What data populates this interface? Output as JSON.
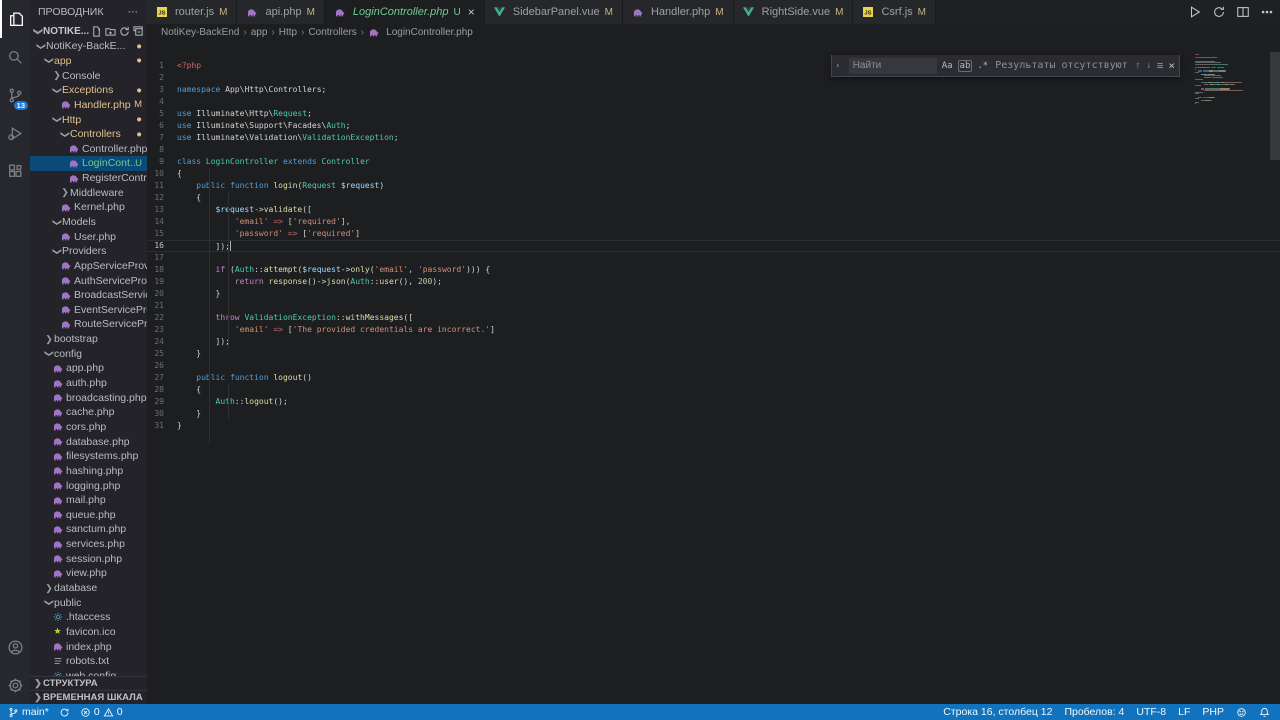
{
  "activity_bar": {
    "scm_badge": "13"
  },
  "sidebar": {
    "title": "ПРОВОДНИК",
    "title_more": "⋯",
    "section": "NOTIKE...",
    "outline": "СТРУКТУРА",
    "timeline": "ВРЕМЕННАЯ ШКАЛА",
    "tree": [
      {
        "label": "NotiKey-BackE...",
        "lvl": 0,
        "kind": "folder",
        "state": "open",
        "badge": "dot"
      },
      {
        "label": "app",
        "lvl": 1,
        "kind": "folder",
        "state": "open",
        "color": "mod",
        "badge": "dot"
      },
      {
        "label": "Console",
        "lvl": 2,
        "kind": "folder",
        "state": "closed"
      },
      {
        "label": "Exceptions",
        "lvl": 2,
        "kind": "folder",
        "state": "open",
        "color": "mod",
        "badge": "dot"
      },
      {
        "label": "Handler.php",
        "lvl": 3,
        "kind": "file",
        "icon": "php",
        "color": "mod",
        "badge": "M"
      },
      {
        "label": "Http",
        "lvl": 2,
        "kind": "folder",
        "state": "open",
        "color": "mod",
        "badge": "dot"
      },
      {
        "label": "Controllers",
        "lvl": 3,
        "kind": "folder",
        "state": "open",
        "color": "mod",
        "badge": "dot"
      },
      {
        "label": "Controller.php",
        "lvl": 4,
        "kind": "file",
        "icon": "php"
      },
      {
        "label": "LoginCont...",
        "lvl": 4,
        "kind": "file",
        "icon": "php",
        "color": "unt",
        "badge": "U",
        "selected": true
      },
      {
        "label": "RegisterContro...",
        "lvl": 4,
        "kind": "file",
        "icon": "php"
      },
      {
        "label": "Middleware",
        "lvl": 3,
        "kind": "folder",
        "state": "closed"
      },
      {
        "label": "Kernel.php",
        "lvl": 3,
        "kind": "file",
        "icon": "php"
      },
      {
        "label": "Models",
        "lvl": 2,
        "kind": "folder",
        "state": "open"
      },
      {
        "label": "User.php",
        "lvl": 3,
        "kind": "file",
        "icon": "php"
      },
      {
        "label": "Providers",
        "lvl": 2,
        "kind": "folder",
        "state": "open"
      },
      {
        "label": "AppServiceProvi...",
        "lvl": 3,
        "kind": "file",
        "icon": "php"
      },
      {
        "label": "AuthServiceProv...",
        "lvl": 3,
        "kind": "file",
        "icon": "php"
      },
      {
        "label": "BroadcastServic...",
        "lvl": 3,
        "kind": "file",
        "icon": "php"
      },
      {
        "label": "EventServicePro...",
        "lvl": 3,
        "kind": "file",
        "icon": "php"
      },
      {
        "label": "RouteServicePro...",
        "lvl": 3,
        "kind": "file",
        "icon": "php"
      },
      {
        "label": "bootstrap",
        "lvl": 1,
        "kind": "folder",
        "state": "closed"
      },
      {
        "label": "config",
        "lvl": 1,
        "kind": "folder",
        "state": "open"
      },
      {
        "label": "app.php",
        "lvl": 2,
        "kind": "file",
        "icon": "php"
      },
      {
        "label": "auth.php",
        "lvl": 2,
        "kind": "file",
        "icon": "php"
      },
      {
        "label": "broadcasting.php",
        "lvl": 2,
        "kind": "file",
        "icon": "php"
      },
      {
        "label": "cache.php",
        "lvl": 2,
        "kind": "file",
        "icon": "php"
      },
      {
        "label": "cors.php",
        "lvl": 2,
        "kind": "file",
        "icon": "php"
      },
      {
        "label": "database.php",
        "lvl": 2,
        "kind": "file",
        "icon": "php"
      },
      {
        "label": "filesystems.php",
        "lvl": 2,
        "kind": "file",
        "icon": "php"
      },
      {
        "label": "hashing.php",
        "lvl": 2,
        "kind": "file",
        "icon": "php"
      },
      {
        "label": "logging.php",
        "lvl": 2,
        "kind": "file",
        "icon": "php"
      },
      {
        "label": "mail.php",
        "lvl": 2,
        "kind": "file",
        "icon": "php"
      },
      {
        "label": "queue.php",
        "lvl": 2,
        "kind": "file",
        "icon": "php"
      },
      {
        "label": "sanctum.php",
        "lvl": 2,
        "kind": "file",
        "icon": "php"
      },
      {
        "label": "services.php",
        "lvl": 2,
        "kind": "file",
        "icon": "php"
      },
      {
        "label": "session.php",
        "lvl": 2,
        "kind": "file",
        "icon": "php"
      },
      {
        "label": "view.php",
        "lvl": 2,
        "kind": "file",
        "icon": "php"
      },
      {
        "label": "database",
        "lvl": 1,
        "kind": "folder",
        "state": "closed"
      },
      {
        "label": "public",
        "lvl": 1,
        "kind": "folder",
        "state": "open"
      },
      {
        "label": ".htaccess",
        "lvl": 2,
        "kind": "file",
        "icon": "gear"
      },
      {
        "label": "favicon.ico",
        "lvl": 2,
        "kind": "file",
        "icon": "star"
      },
      {
        "label": "index.php",
        "lvl": 2,
        "kind": "file",
        "icon": "php"
      },
      {
        "label": "robots.txt",
        "lvl": 2,
        "kind": "file",
        "icon": "txt"
      },
      {
        "label": "web.config",
        "lvl": 2,
        "kind": "file",
        "icon": "gear"
      }
    ]
  },
  "tabs": [
    {
      "name": "router.js",
      "icon": "js",
      "badge": "M"
    },
    {
      "name": "api.php",
      "icon": "php",
      "badge": "M"
    },
    {
      "name": "LoginController.php",
      "icon": "php",
      "badge": "U",
      "active": true
    },
    {
      "name": "SidebarPanel.vue",
      "icon": "vue",
      "badge": "M"
    },
    {
      "name": "Handler.php",
      "icon": "php",
      "badge": "M"
    },
    {
      "name": "RightSide.vue",
      "icon": "vue",
      "badge": "M"
    },
    {
      "name": "Csrf.js",
      "icon": "js",
      "badge": "M"
    }
  ],
  "breadcrumbs": [
    "NotiKey-BackEnd",
    "app",
    "Http",
    "Controllers",
    "LoginController.php"
  ],
  "find": {
    "placeholder": "Найти",
    "match_case": "Aa",
    "whole_word": "ab",
    "regex": ".*",
    "results": "Результаты отсутствуют",
    "prev": "↑",
    "next": "↓",
    "in_selection": "≡",
    "close": "×",
    "toggle": "›"
  },
  "editor": {
    "current_line": 16,
    "lines": [
      {
        "n": 1,
        "t": [
          [
            "<?php",
            "php"
          ]
        ]
      },
      {
        "n": 2,
        "t": []
      },
      {
        "n": 3,
        "t": [
          [
            "namespace",
            "k"
          ],
          [
            " App\\Http\\Controllers;",
            "d"
          ]
        ]
      },
      {
        "n": 4,
        "t": []
      },
      {
        "n": 5,
        "t": [
          [
            "use",
            "k"
          ],
          [
            " Illuminate\\Http\\",
            "d"
          ],
          [
            "Request",
            "cls"
          ],
          [
            ";",
            "d"
          ]
        ]
      },
      {
        "n": 6,
        "t": [
          [
            "use",
            "k"
          ],
          [
            " Illuminate\\Support\\Facades\\",
            "d"
          ],
          [
            "Auth",
            "cls"
          ],
          [
            ";",
            "d"
          ]
        ]
      },
      {
        "n": 7,
        "t": [
          [
            "use",
            "k"
          ],
          [
            " Illuminate\\Validation\\",
            "d"
          ],
          [
            "ValidationException",
            "cls"
          ],
          [
            ";",
            "d"
          ]
        ]
      },
      {
        "n": 8,
        "t": []
      },
      {
        "n": 9,
        "t": [
          [
            "class",
            "k"
          ],
          [
            " ",
            "d"
          ],
          [
            "LoginController",
            "cls"
          ],
          [
            " ",
            "d"
          ],
          [
            "extends",
            "k"
          ],
          [
            " ",
            "d"
          ],
          [
            "Controller",
            "cls"
          ]
        ]
      },
      {
        "n": 10,
        "t": [
          [
            "{",
            "d"
          ]
        ]
      },
      {
        "n": 11,
        "t": [
          [
            "    ",
            "d"
          ],
          [
            "public",
            "k"
          ],
          [
            " ",
            "d"
          ],
          [
            "function",
            "k"
          ],
          [
            " ",
            "d"
          ],
          [
            "login",
            "fn"
          ],
          [
            "(",
            "d"
          ],
          [
            "Request",
            "cls"
          ],
          [
            " ",
            "d"
          ],
          [
            "$request",
            "var"
          ],
          [
            ")",
            "d"
          ]
        ]
      },
      {
        "n": 12,
        "t": [
          [
            "    {",
            "d"
          ]
        ]
      },
      {
        "n": 13,
        "t": [
          [
            "        ",
            "d"
          ],
          [
            "$request",
            "var"
          ],
          [
            "->",
            "d"
          ],
          [
            "validate",
            "fn"
          ],
          [
            "([",
            "d"
          ]
        ]
      },
      {
        "n": 14,
        "t": [
          [
            "            ",
            "d"
          ],
          [
            "'email'",
            "str"
          ],
          [
            " ",
            "d"
          ],
          [
            "=>",
            "op"
          ],
          [
            " [",
            "d"
          ],
          [
            "'required'",
            "str"
          ],
          [
            "],",
            "d"
          ]
        ]
      },
      {
        "n": 15,
        "t": [
          [
            "            ",
            "d"
          ],
          [
            "'password'",
            "str"
          ],
          [
            " ",
            "d"
          ],
          [
            "=>",
            "op"
          ],
          [
            " [",
            "d"
          ],
          [
            "'required'",
            "str"
          ],
          [
            "]",
            "d"
          ]
        ]
      },
      {
        "n": 16,
        "t": [
          [
            "        ]);",
            "d"
          ]
        ]
      },
      {
        "n": 17,
        "t": []
      },
      {
        "n": 18,
        "t": [
          [
            "        ",
            "d"
          ],
          [
            "if",
            "ctl"
          ],
          [
            " (",
            "d"
          ],
          [
            "Auth",
            "cls"
          ],
          [
            "::",
            "d"
          ],
          [
            "attempt",
            "fn"
          ],
          [
            "(",
            "d"
          ],
          [
            "$request",
            "var"
          ],
          [
            "->",
            "d"
          ],
          [
            "only",
            "fn"
          ],
          [
            "(",
            "d"
          ],
          [
            "'email'",
            "str"
          ],
          [
            ", ",
            "d"
          ],
          [
            "'password'",
            "str"
          ],
          [
            "))) {",
            "d"
          ]
        ]
      },
      {
        "n": 19,
        "t": [
          [
            "            ",
            "d"
          ],
          [
            "return",
            "ctl"
          ],
          [
            " ",
            "d"
          ],
          [
            "response",
            "fn"
          ],
          [
            "()->",
            "d"
          ],
          [
            "json",
            "fn"
          ],
          [
            "(",
            "d"
          ],
          [
            "Auth",
            "cls"
          ],
          [
            "::",
            "d"
          ],
          [
            "user",
            "fn"
          ],
          [
            "(), ",
            "d"
          ],
          [
            "200",
            "num"
          ],
          [
            ");",
            "d"
          ]
        ]
      },
      {
        "n": 20,
        "t": [
          [
            "        }",
            "d"
          ]
        ]
      },
      {
        "n": 21,
        "t": []
      },
      {
        "n": 22,
        "t": [
          [
            "        ",
            "d"
          ],
          [
            "throw",
            "ctl"
          ],
          [
            " ",
            "d"
          ],
          [
            "ValidationException",
            "cls"
          ],
          [
            "::",
            "d"
          ],
          [
            "withMessages",
            "fn"
          ],
          [
            "([",
            "d"
          ]
        ]
      },
      {
        "n": 23,
        "t": [
          [
            "            ",
            "d"
          ],
          [
            "'email'",
            "str"
          ],
          [
            " ",
            "d"
          ],
          [
            "=>",
            "op"
          ],
          [
            " [",
            "d"
          ],
          [
            "'The provided credentials are incorrect.'",
            "str"
          ],
          [
            "]",
            "d"
          ]
        ]
      },
      {
        "n": 24,
        "t": [
          [
            "        ]);",
            "d"
          ]
        ]
      },
      {
        "n": 25,
        "t": [
          [
            "    }",
            "d"
          ]
        ]
      },
      {
        "n": 26,
        "t": []
      },
      {
        "n": 27,
        "t": [
          [
            "    ",
            "d"
          ],
          [
            "public",
            "k"
          ],
          [
            " ",
            "d"
          ],
          [
            "function",
            "k"
          ],
          [
            " ",
            "d"
          ],
          [
            "logout",
            "fn"
          ],
          [
            "()",
            "d"
          ]
        ]
      },
      {
        "n": 28,
        "t": [
          [
            "    {",
            "d"
          ]
        ]
      },
      {
        "n": 29,
        "t": [
          [
            "        ",
            "d"
          ],
          [
            "Auth",
            "cls"
          ],
          [
            "::",
            "d"
          ],
          [
            "logout",
            "fn"
          ],
          [
            "();",
            "d"
          ]
        ]
      },
      {
        "n": 30,
        "t": [
          [
            "    }",
            "d"
          ]
        ]
      },
      {
        "n": 31,
        "t": [
          [
            "}",
            "d"
          ]
        ]
      }
    ]
  },
  "status_bar": {
    "branch": "main*",
    "errors": "0",
    "warnings": "0",
    "line_col": "Строка 16, столбец 12",
    "spaces": "Пробелов: 4",
    "encoding": "UTF-8",
    "eol": "LF",
    "lang": "PHP"
  },
  "colors": {
    "statusbar": "#1173bd",
    "selection": "#0a4a77",
    "git_modified": "#e2c08d",
    "git_untracked": "#73c991",
    "scm_badge_bg": "#1d77d3"
  }
}
